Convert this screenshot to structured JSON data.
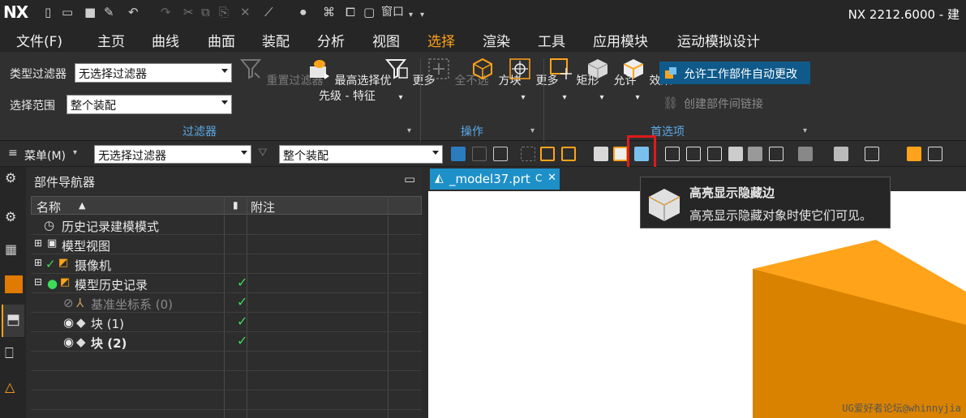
{
  "app": {
    "logo": "NX",
    "title": "NX 2212.6000 - 建"
  },
  "qat": {
    "window_label": "窗口"
  },
  "menu": [
    "文件(F)",
    "主页",
    "曲线",
    "曲面",
    "装配",
    "分析",
    "视图",
    "选择",
    "渲染",
    "工具",
    "应用模块",
    "运动模拟设计"
  ],
  "active_menu": "选择",
  "ribbon": {
    "type_filter_label": "类型过滤器",
    "type_filter_value": "无选择过滤器",
    "scope_label": "选择范围",
    "scope_value": "整个装配",
    "reset_filter": "重置过滤器",
    "highest_priority": "最高选择优",
    "priority_feature": "先级 - 特征",
    "more": "更多",
    "deselect_all": "全不选",
    "block": "方块",
    "rect": "矩形",
    "allow": "允许",
    "effect": "效果",
    "auto_change": "允许工作部件自动更改",
    "create_link": "创建部件间链接",
    "group_filter": "过滤器",
    "group_ops": "操作",
    "group_pref": "首选项"
  },
  "toolbar2": {
    "menu_label": "菜单(M)",
    "filter_value": "无选择过滤器",
    "scope_value": "整个装配"
  },
  "navigator": {
    "title": "部件导航器",
    "col_name": "名称",
    "col_notes": "附注",
    "rows": [
      {
        "label": "历史记录建模模式",
        "checked": false,
        "bold": false,
        "dim": false
      },
      {
        "label": "模型视图",
        "checked": false,
        "bold": false,
        "dim": false
      },
      {
        "label": "摄像机",
        "checked": false,
        "bold": false,
        "dim": false
      },
      {
        "label": "模型历史记录",
        "checked": true,
        "bold": false,
        "dim": false
      },
      {
        "label": "基准坐标系 (0)",
        "checked": true,
        "bold": false,
        "dim": true
      },
      {
        "label": "块 (1)",
        "checked": true,
        "bold": false,
        "dim": false
      },
      {
        "label": "块 (2)",
        "checked": true,
        "bold": true,
        "dim": false
      }
    ]
  },
  "viewport": {
    "tab_label": "_model37.prt",
    "tab_modified": "C"
  },
  "tooltip": {
    "title": "高亮显示隐藏边",
    "desc": "高亮显示隐藏对象时使它们可见。"
  },
  "watermark": "UG爱好者论坛@whinnyjia",
  "colors": {
    "accent": "#ffa31a",
    "check": "#3ddc5a",
    "tab": "#1e90c8",
    "block_top": "#ffa31a",
    "block_side": "#e08a00"
  }
}
